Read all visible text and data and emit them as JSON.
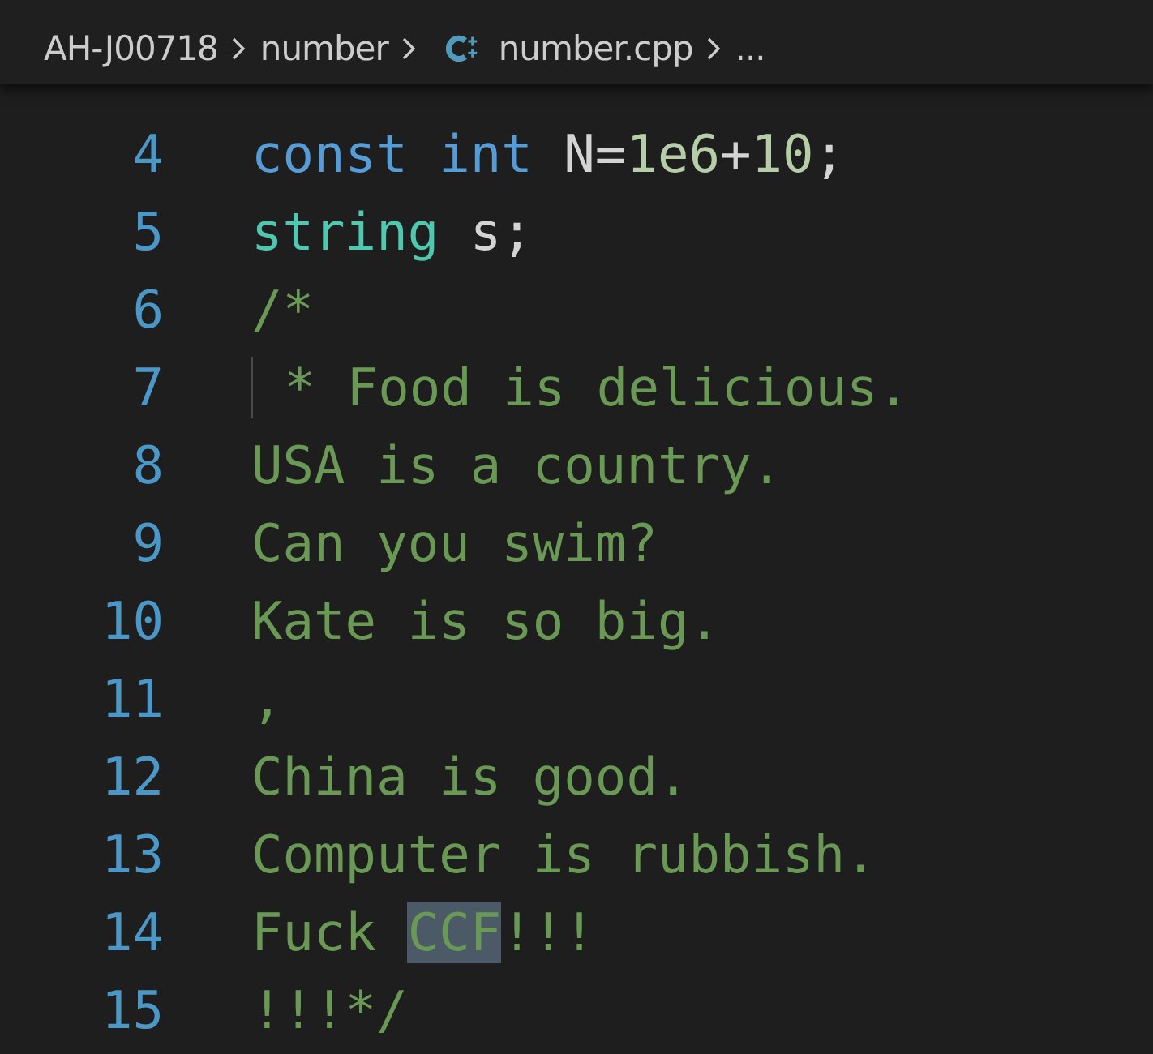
{
  "breadcrumb": [
    {
      "kind": "folder",
      "label": "AH-J00718"
    },
    {
      "kind": "folder",
      "label": "number"
    },
    {
      "kind": "cpp-file",
      "label": "number.cpp"
    },
    {
      "kind": "more",
      "label": "..."
    }
  ],
  "lines": [
    {
      "number": "4",
      "tokens": [
        {
          "kind": "keyword",
          "text": "const int"
        },
        {
          "kind": "plain",
          "text": " N="
        },
        {
          "kind": "number",
          "text": "1e6"
        },
        {
          "kind": "plain",
          "text": "+"
        },
        {
          "kind": "number",
          "text": "10"
        },
        {
          "kind": "plain",
          "text": ";"
        }
      ]
    },
    {
      "number": "5",
      "tokens": [
        {
          "kind": "type",
          "text": "string"
        },
        {
          "kind": "plain",
          "text": " s;"
        }
      ]
    },
    {
      "number": "6",
      "tokens": [
        {
          "kind": "comment",
          "text": "/*"
        }
      ]
    },
    {
      "number": "7",
      "indent_guide": true,
      "tokens": [
        {
          "kind": "comment",
          "text": " * Food is delicious."
        }
      ]
    },
    {
      "number": "8",
      "tokens": [
        {
          "kind": "comment",
          "text": "USA is a country."
        }
      ]
    },
    {
      "number": "9",
      "tokens": [
        {
          "kind": "comment",
          "text": "Can you swim?"
        }
      ]
    },
    {
      "number": "10",
      "tokens": [
        {
          "kind": "comment",
          "text": "Kate is so big."
        }
      ]
    },
    {
      "number": "11",
      "tokens": [
        {
          "kind": "comment",
          "text": ","
        }
      ]
    },
    {
      "number": "12",
      "tokens": [
        {
          "kind": "comment",
          "text": "China is good."
        }
      ]
    },
    {
      "number": "13",
      "tokens": [
        {
          "kind": "comment",
          "text": "Computer is rubbish."
        }
      ]
    },
    {
      "number": "14",
      "tokens": [
        {
          "kind": "comment",
          "text": "Fuck "
        },
        {
          "kind": "comment",
          "text": "CCF",
          "highlighted": true
        },
        {
          "kind": "comment",
          "text": "!!!"
        }
      ]
    },
    {
      "number": "15",
      "tokens": [
        {
          "kind": "comment",
          "text": "!!!*/"
        }
      ]
    }
  ]
}
